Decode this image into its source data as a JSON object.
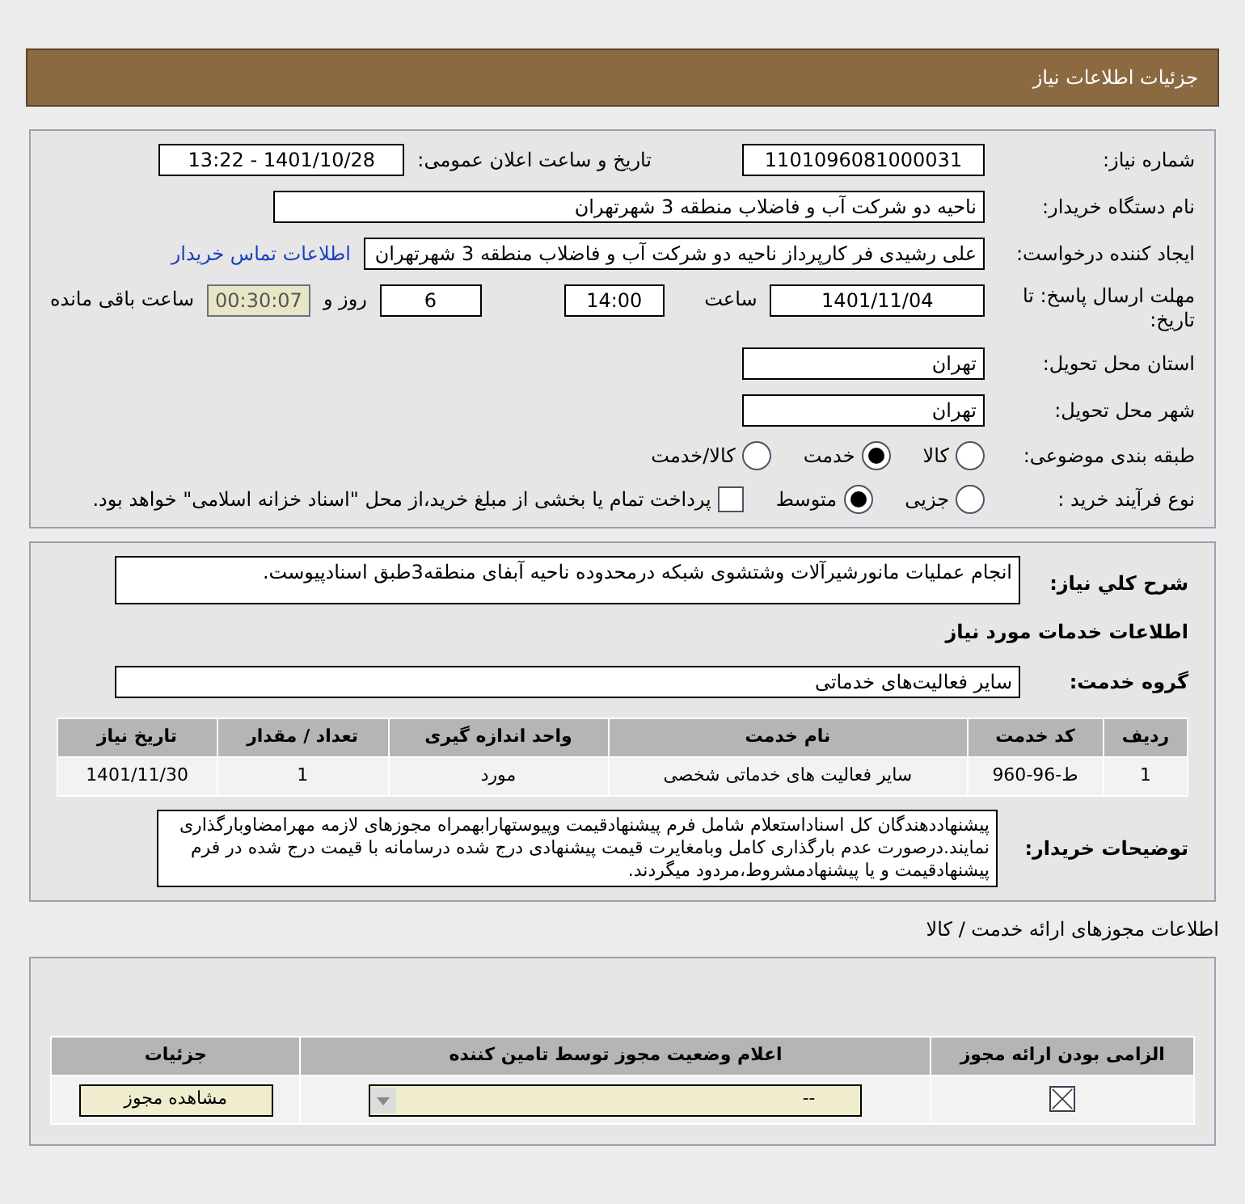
{
  "header": {
    "title": "جزئیات اطلاعات نیاز"
  },
  "need_number": {
    "label": "شماره نیاز:",
    "value": "1101096081000031"
  },
  "announce": {
    "label": "تاریخ و ساعت اعلان عمومی:",
    "value": "1401/10/28 - 13:22"
  },
  "buyer": {
    "label": "نام دستگاه خریدار:",
    "value": "ناحیه دو شرکت آب و فاضلاب منطقه 3 شهرتهران"
  },
  "creator": {
    "label": "ایجاد کننده درخواست:",
    "value": "علی رشیدی فر کارپرداز ناحیه دو شرکت آب و فاضلاب منطقه 3 شهرتهران",
    "link": "اطلاعات تماس خریدار"
  },
  "deadline": {
    "label": "مهلت ارسال پاسخ: تا تاریخ:",
    "date": "1401/11/04",
    "time_label": "ساعت",
    "time": "14:00",
    "days": "6",
    "days_label": "روز و",
    "remaining": "00:30:07",
    "remaining_label": "ساعت باقی مانده"
  },
  "province": {
    "label": "استان محل تحویل:",
    "value": "تهران"
  },
  "city": {
    "label": "شهر محل تحویل:",
    "value": "تهران"
  },
  "category": {
    "label": "طبقه بندی موضوعی:",
    "options": [
      {
        "label": "کالا",
        "selected": false
      },
      {
        "label": "خدمت",
        "selected": true
      },
      {
        "label": "کالا/خدمت",
        "selected": false
      }
    ]
  },
  "process": {
    "label": "نوع فرآیند خرید :",
    "options": [
      {
        "label": "جزیی",
        "selected": false
      },
      {
        "label": "متوسط",
        "selected": true
      }
    ],
    "payment": {
      "checked": false,
      "label": "پرداخت تمام یا بخشی از مبلغ خرید،از محل \"اسناد خزانه اسلامی\" خواهد بود."
    }
  },
  "summary": {
    "label": "شرح کلي نياز:",
    "value": "انجام عملیات مانورشیرآلات وشتشوی شبکه درمحدوده ناحیه آبفای منطقه3طبق اسنادپیوست."
  },
  "services_title": "اطلاعات خدمات مورد نیاز",
  "service_group": {
    "label": "گروه خدمت:",
    "value": "سایر فعالیت‌های خدماتی"
  },
  "services_table": {
    "columns": [
      "ردیف",
      "کد خدمت",
      "نام خدمت",
      "واحد اندازه گیری",
      "تعداد / مقدار",
      "تاریخ نیاز"
    ],
    "rows": [
      [
        "1",
        "ط-96-960",
        "سایر فعالیت های خدماتی شخصی",
        "مورد",
        "1",
        "1401/11/30"
      ]
    ]
  },
  "buyer_notes": {
    "label": "توضیحات خریدار:",
    "value": "پیشنهاددهندگان کل اسناداستعلام شامل فرم پیشنهادقیمت وپیوستهارابهمراه مجوزهای لازمه مهرامضاوبارگذاری نمایند.درصورت عدم بارگذاری کامل وبامغایرت قیمت پیشنهادی درج شده درسامانه با قیمت درج شده در فرم پیشنهادقیمت و یا پیشنهادمشروط،مردود میگردند."
  },
  "permits_title": "اطلاعات مجوزهای ارائه خدمت / کالا",
  "permits_table": {
    "columns": [
      "الزامی بودن ارائه مجوز",
      "اعلام وضعیت مجوز توسط تامین کننده",
      "جزئیات"
    ],
    "rows": [
      {
        "required": true,
        "status": "--",
        "button": "مشاهده مجوز"
      }
    ]
  }
}
